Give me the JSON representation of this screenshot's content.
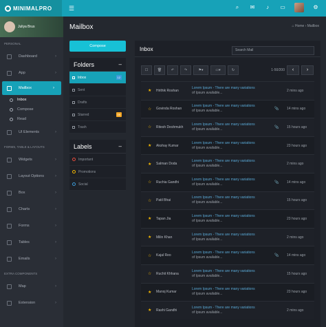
{
  "brand": "MINIMALPRO",
  "user": {
    "name": "Juliya Brus"
  },
  "sidebar": {
    "personal": "PERSONAL",
    "items1": [
      {
        "label": "Dashboard"
      },
      {
        "label": "App"
      }
    ],
    "mailbox": "Mailbox",
    "subs": [
      {
        "label": "Inbox"
      },
      {
        "label": "Compose"
      },
      {
        "label": "Read"
      }
    ],
    "ui": "UI Elements",
    "forms_header": "FORMS, TABLE & LAYOUTS",
    "items2": [
      {
        "label": "Widgets"
      },
      {
        "label": "Layout Options"
      },
      {
        "label": "Box"
      },
      {
        "label": "Charts"
      },
      {
        "label": "Forms"
      },
      {
        "label": "Tables"
      },
      {
        "label": "Emails"
      }
    ],
    "extra_header": "EXTRA COMPONENTS",
    "items3": [
      {
        "label": "Map"
      },
      {
        "label": "Extension"
      }
    ]
  },
  "header": {
    "title": "Mailbox",
    "crumb_home": "Home",
    "crumb_current": "Mailbox"
  },
  "compose_label": "Compose",
  "folders": {
    "title": "Folders",
    "items": [
      {
        "label": "Inbox",
        "badge": "12"
      },
      {
        "label": "Sent"
      },
      {
        "label": "Drafts"
      },
      {
        "label": "Starred",
        "badge": "09"
      },
      {
        "label": "Trash"
      }
    ]
  },
  "labels": {
    "title": "Labels",
    "items": [
      {
        "label": "Important",
        "color": "#e74c3c"
      },
      {
        "label": "Promotions",
        "color": "#f5b800"
      },
      {
        "label": "Social",
        "color": "#3b9bd9"
      }
    ]
  },
  "inbox": {
    "title": "Inbox",
    "search_placeholder": "Search Mail",
    "pager_text": "1-50/200"
  },
  "subject": "Lorem Ipsum - There are many variations",
  "body": "of Ipsum available...",
  "emails": [
    {
      "name": "Hrithik Roshan",
      "starred": true,
      "clip": "",
      "time": "2 mins ago"
    },
    {
      "name": "Govinda Roshan",
      "starred": false,
      "clip": "📎",
      "time": "14 mins ago"
    },
    {
      "name": "Ritesh Deshmukh",
      "starred": false,
      "clip": "📎",
      "time": "15 hours ago"
    },
    {
      "name": "Akshay Kumar",
      "starred": true,
      "clip": "",
      "time": "23 hours ago"
    },
    {
      "name": "Salman Doda",
      "starred": true,
      "clip": "",
      "time": "2 mins ago"
    },
    {
      "name": "Ruchia Gandhi",
      "starred": false,
      "clip": "📎",
      "time": "14 mins ago"
    },
    {
      "name": "Patil Bhai",
      "starred": false,
      "clip": "",
      "time": "15 hours ago"
    },
    {
      "name": "Tapan Jia",
      "starred": true,
      "clip": "",
      "time": "23 hours ago"
    },
    {
      "name": "Milin Khan",
      "starred": true,
      "clip": "",
      "time": "2 mins ago"
    },
    {
      "name": "Kajal Reo",
      "starred": false,
      "clip": "📎",
      "time": "14 mins ago"
    },
    {
      "name": "Ruchit Khhana",
      "starred": false,
      "clip": "",
      "time": "15 hours ago"
    },
    {
      "name": "Manoj Kumar",
      "starred": true,
      "clip": "",
      "time": "23 hours ago"
    },
    {
      "name": "Rashi Gandhi",
      "starred": true,
      "clip": "",
      "time": "2 mins ago"
    }
  ]
}
